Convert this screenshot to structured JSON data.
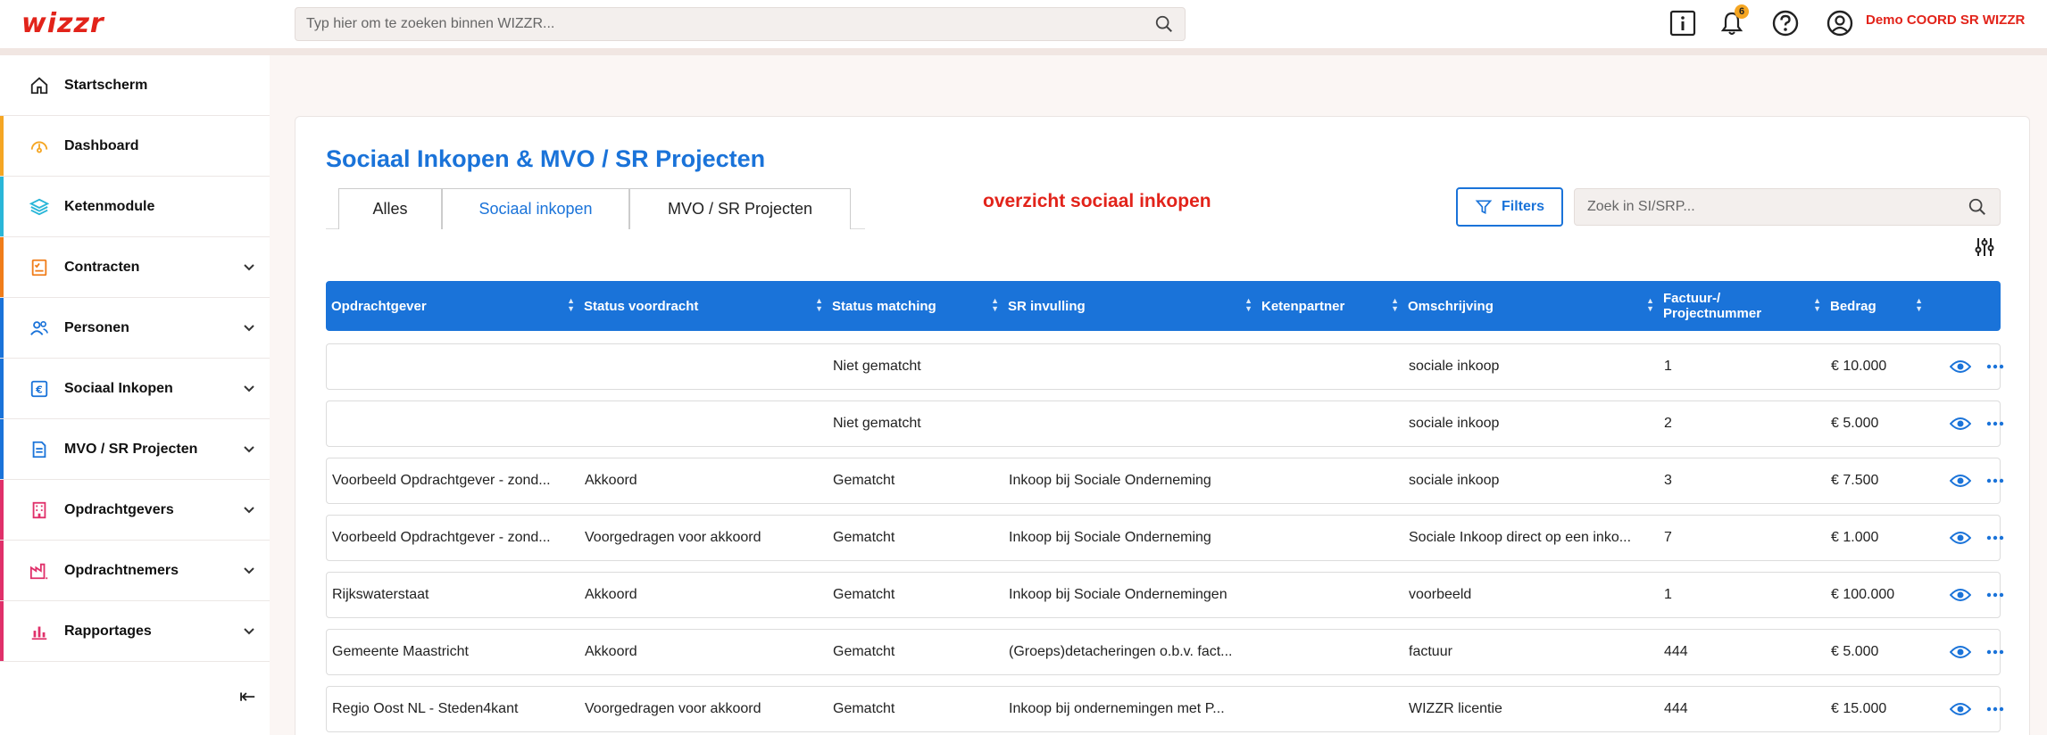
{
  "app": {
    "logo": "wizzr"
  },
  "search": {
    "placeholder": "Typ hier om te zoeken binnen WIZZR..."
  },
  "topbar": {
    "notification_count": "6",
    "user_name": "Demo COORD SR WIZZR"
  },
  "colors": {
    "brand_red": "#e2231a",
    "accent_blue": "#1a73d9",
    "badge": "#f5a623"
  },
  "sidebar": {
    "items": [
      {
        "label": "Startscherm",
        "icon": "home-icon",
        "accent": "",
        "has_chevron": false
      },
      {
        "label": "Dashboard",
        "icon": "gauge-icon",
        "accent": "#f5a623",
        "has_chevron": false
      },
      {
        "label": "Ketenmodule",
        "icon": "layers-icon",
        "accent": "#29b6d8",
        "has_chevron": false
      },
      {
        "label": "Contracten",
        "icon": "contract-icon",
        "accent": "#f07d1a",
        "has_chevron": true
      },
      {
        "label": "Personen",
        "icon": "people-icon",
        "accent": "#1a73d9",
        "has_chevron": true
      },
      {
        "label": "Sociaal Inkopen",
        "icon": "euro-icon",
        "accent": "#1a73d9",
        "has_chevron": true
      },
      {
        "label": "MVO / SR Projecten",
        "icon": "document-icon",
        "accent": "#1a73d9",
        "has_chevron": true
      },
      {
        "label": "Opdrachtgevers",
        "icon": "building-icon",
        "accent": "#e0306a",
        "has_chevron": true
      },
      {
        "label": "Opdrachtnemers",
        "icon": "factory-icon",
        "accent": "#e0306a",
        "has_chevron": true
      },
      {
        "label": "Rapportages",
        "icon": "bar-chart-icon",
        "accent": "#e0306a",
        "has_chevron": true
      }
    ],
    "collapse_glyph": "⇤"
  },
  "main": {
    "title": "Sociaal Inkopen & MVO / SR Projecten",
    "tabs": [
      {
        "label": "Alles"
      },
      {
        "label": "Sociaal inkopen"
      },
      {
        "label": "MVO / SR Projecten"
      }
    ],
    "note": "overzicht sociaal inkopen",
    "filters_label": "Filters",
    "search_placeholder": "Zoek in SI/SRP..."
  },
  "table": {
    "columns": [
      "Opdrachtgever",
      "Status voordracht",
      "Status matching",
      "SR invulling",
      "Ketenpartner",
      "Omschrijving",
      "Factuur-/ Projectnummer",
      "Bedrag"
    ],
    "rows": [
      [
        "",
        "",
        "Niet gematcht",
        "",
        "",
        "sociale inkoop",
        "1",
        "€ 10.000"
      ],
      [
        "",
        "",
        "Niet gematcht",
        "",
        "",
        "sociale inkoop",
        "2",
        "€ 5.000"
      ],
      [
        "Voorbeeld Opdrachtgever - zond...",
        "Akkoord",
        "Gematcht",
        "Inkoop bij Sociale Onderneming",
        "",
        "sociale inkoop",
        "3",
        "€ 7.500"
      ],
      [
        "Voorbeeld Opdrachtgever - zond...",
        "Voorgedragen voor akkoord",
        "Gematcht",
        "Inkoop bij Sociale Onderneming",
        "",
        "Sociale Inkoop direct op een inko...",
        "7",
        "€ 1.000"
      ],
      [
        "Rijkswaterstaat",
        "Akkoord",
        "Gematcht",
        "Inkoop bij Sociale Ondernemingen",
        "",
        "voorbeeld",
        "1",
        "€ 100.000"
      ],
      [
        "Gemeente Maastricht",
        "Akkoord",
        "Gematcht",
        "(Groeps)detacheringen o.b.v. fact...",
        "",
        "factuur",
        "444",
        "€ 5.000"
      ],
      [
        "Regio Oost NL - Steden4kant",
        "Voorgedragen voor akkoord",
        "Gematcht",
        "Inkoop bij ondernemingen met P...",
        "",
        "WIZZR licentie",
        "444",
        "€ 15.000"
      ]
    ]
  }
}
